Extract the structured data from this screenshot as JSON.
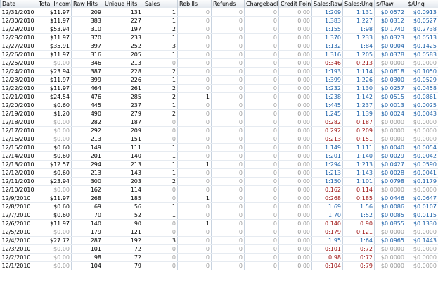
{
  "columns": [
    "Date",
    "Total Income",
    "Raw Hits",
    "Unique Hits",
    "Sales",
    "Rebills",
    "Refunds",
    "Chargebacks",
    "Credit Points",
    "Sales:Raw",
    "Sales:Unq",
    "$/Raw",
    "$/Unq"
  ],
  "rows": [
    [
      "12/31/2010",
      "$11.97",
      "209",
      "131",
      "1",
      "0",
      "0",
      "0",
      "0.00",
      "1:209",
      "1:131",
      "$0.0572",
      "$0.0913"
    ],
    [
      "12/30/2010",
      "$11.97",
      "383",
      "227",
      "1",
      "0",
      "0",
      "0",
      "0.00",
      "1:383",
      "1:227",
      "$0.0312",
      "$0.0527"
    ],
    [
      "12/29/2010",
      "$53.94",
      "310",
      "197",
      "2",
      "0",
      "0",
      "0",
      "0.00",
      "1:155",
      "1:98",
      "$0.1740",
      "$0.2738"
    ],
    [
      "12/28/2010",
      "$11.97",
      "370",
      "233",
      "1",
      "0",
      "0",
      "0",
      "0.00",
      "1:370",
      "1:233",
      "$0.0323",
      "$0.0513"
    ],
    [
      "12/27/2010",
      "$35.91",
      "397",
      "252",
      "3",
      "0",
      "0",
      "0",
      "0.00",
      "1:132",
      "1:84",
      "$0.0904",
      "$0.1425"
    ],
    [
      "12/26/2010",
      "$11.97",
      "316",
      "205",
      "1",
      "0",
      "0",
      "0",
      "0.00",
      "1:316",
      "1:205",
      "$0.0378",
      "$0.0583"
    ],
    [
      "12/25/2010",
      "$0.00",
      "346",
      "213",
      "0",
      "0",
      "0",
      "0",
      "0.00",
      "0:346",
      "0:213",
      "$0.0000",
      "$0.0000"
    ],
    [
      "12/24/2010",
      "$23.94",
      "387",
      "228",
      "2",
      "0",
      "0",
      "0",
      "0.00",
      "1:193",
      "1:114",
      "$0.0618",
      "$0.1050"
    ],
    [
      "12/23/2010",
      "$11.97",
      "399",
      "226",
      "1",
      "0",
      "0",
      "0",
      "0.00",
      "1:399",
      "1:226",
      "$0.0300",
      "$0.0529"
    ],
    [
      "12/22/2010",
      "$11.97",
      "464",
      "261",
      "2",
      "0",
      "0",
      "0",
      "0.00",
      "1:232",
      "1:130",
      "$0.0257",
      "$0.0458"
    ],
    [
      "12/21/2010",
      "$24.54",
      "476",
      "285",
      "2",
      "1",
      "0",
      "0",
      "0.00",
      "1:238",
      "1:142",
      "$0.0515",
      "$0.0861"
    ],
    [
      "12/20/2010",
      "$0.60",
      "445",
      "237",
      "1",
      "0",
      "0",
      "0",
      "0.00",
      "1:445",
      "1:237",
      "$0.0013",
      "$0.0025"
    ],
    [
      "12/19/2010",
      "$1.20",
      "490",
      "279",
      "2",
      "0",
      "0",
      "0",
      "0.00",
      "1:245",
      "1:139",
      "$0.0024",
      "$0.0043"
    ],
    [
      "12/18/2010",
      "$0.00",
      "282",
      "187",
      "0",
      "0",
      "0",
      "0",
      "0.00",
      "0:282",
      "0:187",
      "$0.0000",
      "$0.0000"
    ],
    [
      "12/17/2010",
      "$0.00",
      "292",
      "209",
      "0",
      "0",
      "0",
      "0",
      "0.00",
      "0:292",
      "0:209",
      "$0.0000",
      "$0.0000"
    ],
    [
      "12/16/2010",
      "$0.00",
      "213",
      "151",
      "0",
      "0",
      "0",
      "0",
      "0.00",
      "0:213",
      "0:151",
      "$0.0000",
      "$0.0000"
    ],
    [
      "12/15/2010",
      "$0.60",
      "149",
      "111",
      "1",
      "0",
      "0",
      "0",
      "0.00",
      "1:149",
      "1:111",
      "$0.0040",
      "$0.0054"
    ],
    [
      "12/14/2010",
      "$0.60",
      "201",
      "140",
      "1",
      "0",
      "0",
      "0",
      "0.00",
      "1:201",
      "1:140",
      "$0.0029",
      "$0.0042"
    ],
    [
      "12/13/2010",
      "$12.57",
      "294",
      "213",
      "1",
      "1",
      "0",
      "0",
      "0.00",
      "1:294",
      "1:213",
      "$0.0427",
      "$0.0590"
    ],
    [
      "12/12/2010",
      "$0.60",
      "213",
      "143",
      "1",
      "0",
      "0",
      "0",
      "0.00",
      "1:213",
      "1:143",
      "$0.0028",
      "$0.0041"
    ],
    [
      "12/11/2010",
      "$23.94",
      "300",
      "203",
      "2",
      "0",
      "0",
      "0",
      "0.00",
      "1:150",
      "1:101",
      "$0.0798",
      "$0.1179"
    ],
    [
      "12/10/2010",
      "$0.00",
      "162",
      "114",
      "0",
      "0",
      "0",
      "0",
      "0.00",
      "0:162",
      "0:114",
      "$0.0000",
      "$0.0000"
    ],
    [
      "12/9/2010",
      "$11.97",
      "268",
      "185",
      "0",
      "1",
      "0",
      "0",
      "0.00",
      "0:268",
      "0:185",
      "$0.0446",
      "$0.0647"
    ],
    [
      "12/8/2010",
      "$0.60",
      "69",
      "56",
      "1",
      "0",
      "0",
      "0",
      "0.00",
      "1:69",
      "1:56",
      "$0.0086",
      "$0.0107"
    ],
    [
      "12/7/2010",
      "$0.60",
      "70",
      "52",
      "1",
      "0",
      "0",
      "0",
      "0.00",
      "1:70",
      "1:52",
      "$0.0085",
      "$0.0115"
    ],
    [
      "12/6/2010",
      "$11.97",
      "140",
      "90",
      "0",
      "1",
      "0",
      "0",
      "0.00",
      "0:140",
      "0:90",
      "$0.0855",
      "$0.1330"
    ],
    [
      "12/5/2010",
      "$0.00",
      "179",
      "121",
      "0",
      "0",
      "0",
      "0",
      "0.00",
      "0:179",
      "0:121",
      "$0.0000",
      "$0.0000"
    ],
    [
      "12/4/2010",
      "$27.72",
      "287",
      "192",
      "3",
      "0",
      "0",
      "0",
      "0.00",
      "1:95",
      "1:64",
      "$0.0965",
      "$0.1443"
    ],
    [
      "12/3/2010",
      "$0.00",
      "101",
      "72",
      "0",
      "0",
      "0",
      "0",
      "0.00",
      "0:101",
      "0:72",
      "$0.0000",
      "$0.0000"
    ],
    [
      "12/2/2010",
      "$0.00",
      "98",
      "72",
      "0",
      "0",
      "0",
      "0",
      "0.00",
      "0:98",
      "0:72",
      "$0.0000",
      "$0.0000"
    ],
    [
      "12/1/2010",
      "$0.00",
      "104",
      "79",
      "0",
      "0",
      "0",
      "0",
      "0.00",
      "0:104",
      "0:79",
      "$0.0000",
      "$0.0000"
    ]
  ],
  "colors": {
    "header_bg": "#e8ecf1",
    "grid_line": "#c8d3e0",
    "ratio_blue": "#1a5fa8",
    "ratio_red": "#9b0e0e",
    "zero_grey": "#9a9a9a"
  }
}
